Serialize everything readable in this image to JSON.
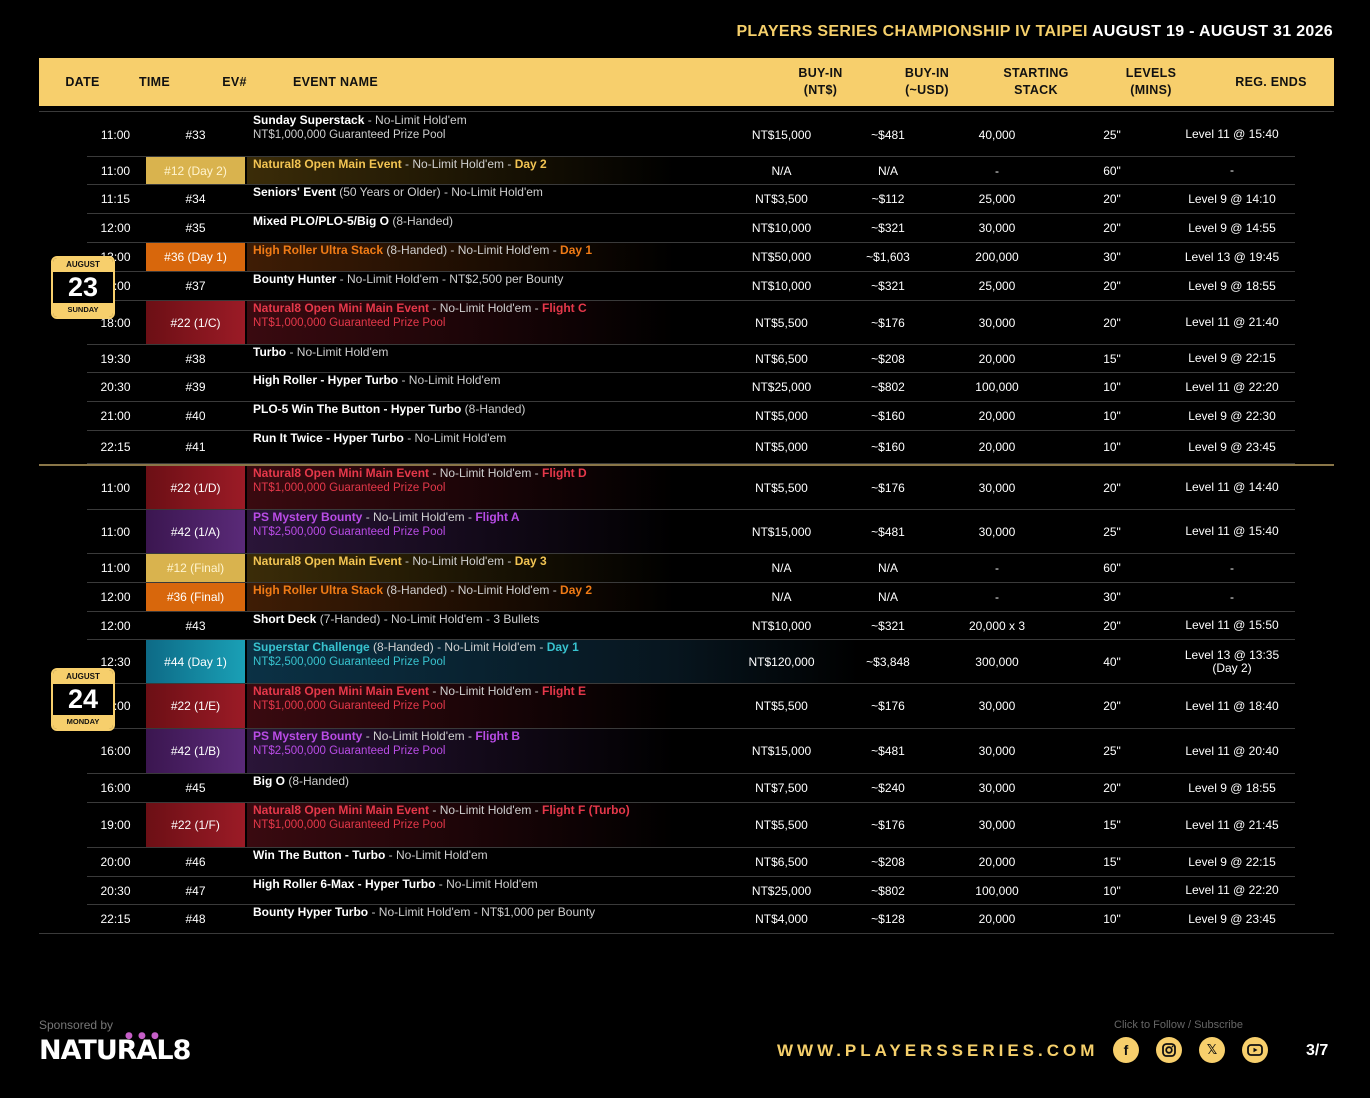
{
  "title": {
    "gold": "PLAYERS SERIES CHAMPIONSHIP IV TAIPEI",
    "dates": "AUGUST 19 - AUGUST 31 2026"
  },
  "headers": {
    "date": "DATE",
    "time": "TIME",
    "ev": "EV#",
    "name": "EVENT NAME",
    "buyin_1": "BUY-IN",
    "buyin_2": "(NT$)",
    "usd_1": "BUY-IN",
    "usd_2": "(~USD)",
    "stack_1": "STARTING",
    "stack_2": "STACK",
    "levels_1": "LEVELS",
    "levels_2": "(MINS)",
    "reg": "REG. ENDS"
  },
  "days": [
    {
      "month": "AUGUST",
      "day": "23",
      "weekday": "SUNDAY"
    },
    {
      "month": "AUGUST",
      "day": "24",
      "weekday": "MONDAY"
    }
  ],
  "rows": [
    {
      "time": "11:00",
      "ev": "#33",
      "title": "Sunday Superstack",
      "rest": " - No-Limit Hold'em",
      "sub": "NT$1,000,000 Guaranteed Prize Pool",
      "buyin": "NT$15,000",
      "usd": "~$481",
      "stack": "40,000",
      "levels": "25\"",
      "reg": "Level 11 @ 15:40",
      "reg2": ""
    },
    {
      "time": "11:00",
      "ev": "#12 (Day 2)",
      "title": "Natural8 Open Main Event",
      "rest": " - No-Limit Hold'em - ",
      "flight": "Day 2",
      "buyin": "N/A",
      "usd": "N/A",
      "stack": "-",
      "levels": "60\"",
      "reg": "-",
      "reg2": ""
    },
    {
      "time": "11:15",
      "ev": "#34",
      "title": "Seniors' Event",
      "rest": " (50 Years or Older) - No-Limit Hold'em",
      "buyin": "NT$3,500",
      "usd": "~$112",
      "stack": "25,000",
      "levels": "20\"",
      "reg": "Level 9 @ 14:10",
      "reg2": ""
    },
    {
      "time": "12:00",
      "ev": "#35",
      "title": "Mixed PLO/PLO-5/Big O",
      "rest": " (8-Handed)",
      "buyin": "NT$10,000",
      "usd": "~$321",
      "stack": "30,000",
      "levels": "20\"",
      "reg": "Level 9 @ 14:55",
      "reg2": ""
    },
    {
      "time": "13:00",
      "ev": "#36 (Day 1)",
      "title": "High Roller Ultra Stack",
      "rest": " (8-Handed) - No-Limit Hold'em - ",
      "flight": "Day 1",
      "buyin": "NT$50,000",
      "usd": "~$1,603",
      "stack": "200,000",
      "levels": "30\"",
      "reg": "Level 13 @ 19:45",
      "reg2": ""
    },
    {
      "time": "16:00",
      "ev": "#37",
      "title": "Bounty Hunter",
      "rest": "  - No-Limit Hold'em - NT$2,500 per Bounty",
      "buyin": "NT$10,000",
      "usd": "~$321",
      "stack": "25,000",
      "levels": "20\"",
      "reg": "Level 9 @ 18:55",
      "reg2": ""
    },
    {
      "time": "18:00",
      "ev": "#22 (1/C)",
      "title": "Natural8 Open Mini Main Event",
      "rest": " - No-Limit Hold'em - ",
      "flight": "Flight C",
      "sub": "NT$1,000,000 Guaranteed Prize Pool",
      "buyin": "NT$5,500",
      "usd": "~$176",
      "stack": "30,000",
      "levels": "20\"",
      "reg": "Level 11 @ 21:40",
      "reg2": ""
    },
    {
      "time": "19:30",
      "ev": "#38",
      "title": "Turbo",
      "rest": " - No-Limit Hold'em",
      "buyin": "NT$6,500",
      "usd": "~$208",
      "stack": "20,000",
      "levels": "15\"",
      "reg": "Level 9 @ 22:15",
      "reg2": ""
    },
    {
      "time": "20:30",
      "ev": "#39",
      "title": "High Roller - Hyper Turbo",
      "rest": " - No-Limit Hold'em",
      "buyin": "NT$25,000",
      "usd": "~$802",
      "stack": "100,000",
      "levels": "10\"",
      "reg": "Level 11 @ 22:20",
      "reg2": ""
    },
    {
      "time": "21:00",
      "ev": "#40",
      "title": "PLO-5 Win The Button - Hyper Turbo",
      "rest": " (8-Handed)",
      "buyin": "NT$5,000",
      "usd": "~$160",
      "stack": "20,000",
      "levels": "10\"",
      "reg": "Level 9 @ 22:30",
      "reg2": ""
    },
    {
      "time": "22:15",
      "ev": "#41",
      "title": "Run It Twice - Hyper Turbo",
      "rest": " - No-Limit Hold'em",
      "buyin": "NT$5,000",
      "usd": "~$160",
      "stack": "20,000",
      "levels": "10\"",
      "reg": "Level 9 @ 23:45",
      "reg2": ""
    },
    {
      "time": "11:00",
      "ev": "#22 (1/D)",
      "title": "Natural8 Open Mini Main Event",
      "rest": " - No-Limit Hold'em - ",
      "flight": "Flight D",
      "sub": "NT$1,000,000 Guaranteed Prize Pool",
      "buyin": "NT$5,500",
      "usd": "~$176",
      "stack": "30,000",
      "levels": "20\"",
      "reg": "Level 11 @ 14:40",
      "reg2": ""
    },
    {
      "time": "11:00",
      "ev": "#42 (1/A)",
      "title": "PS Mystery Bounty",
      "rest": " - No-Limit Hold'em - ",
      "flight": "Flight A",
      "sub": "NT$2,500,000 Guaranteed Prize Pool",
      "buyin": "NT$15,000",
      "usd": "~$481",
      "stack": "30,000",
      "levels": "25\"",
      "reg": "Level 11 @ 15:40",
      "reg2": ""
    },
    {
      "time": "11:00",
      "ev": "#12 (Final)",
      "title": "Natural8 Open Main Event",
      "rest": " - No-Limit Hold'em - ",
      "flight": "Day 3",
      "buyin": "N/A",
      "usd": "N/A",
      "stack": "-",
      "levels": "60\"",
      "reg": "-",
      "reg2": ""
    },
    {
      "time": "12:00",
      "ev": "#36 (Final)",
      "title": "High Roller Ultra Stack",
      "rest": " (8-Handed) - No-Limit Hold'em - ",
      "flight": "Day 2",
      "buyin": "N/A",
      "usd": "N/A",
      "stack": "-",
      "levels": "30\"",
      "reg": "-",
      "reg2": ""
    },
    {
      "time": "12:00",
      "ev": "#43",
      "title": "Short Deck",
      "rest": " (7-Handed) - No-Limit Hold'em - 3 Bullets",
      "buyin": "NT$10,000",
      "usd": "~$321",
      "stack": "20,000 x 3",
      "levels": "20\"",
      "reg": "Level 11 @ 15:50",
      "reg2": ""
    },
    {
      "time": "12:30",
      "ev": "#44 (Day 1)",
      "title": "Superstar Challenge",
      "rest": " (8-Handed) - No-Limit Hold'em - ",
      "flight": "Day 1",
      "sub": "NT$2,500,000 Guaranteed Prize Pool",
      "buyin": "NT$120,000",
      "usd": "~$3,848",
      "stack": "300,000",
      "levels": "40\"",
      "reg": "Level 13 @ 13:35",
      "reg2": "(Day 2)"
    },
    {
      "time": "15:00",
      "ev": "#22 (1/E)",
      "title": "Natural8 Open Mini Main Event",
      "rest": " - No-Limit Hold'em - ",
      "flight": "Flight E",
      "sub": "NT$1,000,000 Guaranteed Prize Pool",
      "buyin": "NT$5,500",
      "usd": "~$176",
      "stack": "30,000",
      "levels": "20\"",
      "reg": "Level 11 @ 18:40",
      "reg2": ""
    },
    {
      "time": "16:00",
      "ev": "#42 (1/B)",
      "title": "PS Mystery Bounty",
      "rest": " - No-Limit Hold'em - ",
      "flight": "Flight B",
      "sub": "NT$2,500,000 Guaranteed Prize Pool",
      "buyin": "NT$15,000",
      "usd": "~$481",
      "stack": "30,000",
      "levels": "25\"",
      "reg": "Level 11 @ 20:40",
      "reg2": ""
    },
    {
      "time": "16:00",
      "ev": "#45",
      "title": "Big O",
      "rest": " (8-Handed)",
      "buyin": "NT$7,500",
      "usd": "~$240",
      "stack": "30,000",
      "levels": "20\"",
      "reg": "Level 9 @ 18:55",
      "reg2": ""
    },
    {
      "time": "19:00",
      "ev": "#22 (1/F)",
      "title": "Natural8 Open Mini Main Event",
      "rest": " - No-Limit Hold'em - ",
      "flight": "Flight F (Turbo)",
      "sub": "NT$1,000,000 Guaranteed Prize Pool",
      "buyin": "NT$5,500",
      "usd": "~$176",
      "stack": "30,000",
      "levels": "15\"",
      "reg": "Level 11 @ 21:45",
      "reg2": ""
    },
    {
      "time": "20:00",
      "ev": "#46",
      "title": "Win The Button - Turbo",
      "rest": " - No-Limit Hold'em",
      "buyin": "NT$6,500",
      "usd": "~$208",
      "stack": "20,000",
      "levels": "15\"",
      "reg": "Level 9 @ 22:15",
      "reg2": ""
    },
    {
      "time": "20:30",
      "ev": "#47",
      "title": "High Roller 6-Max - Hyper Turbo",
      "rest": " - No-Limit Hold'em",
      "buyin": "NT$25,000",
      "usd": "~$802",
      "stack": "100,000",
      "levels": "10\"",
      "reg": "Level 11 @ 22:20",
      "reg2": ""
    },
    {
      "time": "22:15",
      "ev": "#48",
      "title": "Bounty Hyper Turbo",
      "rest": " - No-Limit Hold'em - NT$1,000 per Bounty",
      "buyin": "NT$4,000",
      "usd": "~$128",
      "stack": "20,000",
      "levels": "10\"",
      "reg": "Level 9 @ 23:45",
      "reg2": ""
    }
  ],
  "footer": {
    "sponsor": "Sponsored by",
    "logo": "NATURAL8",
    "url": "WWW.PLAYERSSERIES.COM",
    "follow": "Click to Follow / Subscribe",
    "page": "3/7"
  },
  "social_icons": [
    "facebook-icon",
    "instagram-icon",
    "x-icon",
    "youtube-icon"
  ]
}
